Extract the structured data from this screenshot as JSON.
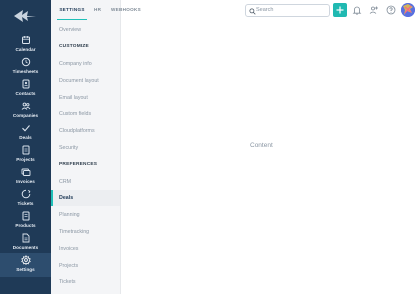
{
  "tabs": [
    {
      "label": "SETTINGS",
      "active": true
    },
    {
      "label": "HR",
      "active": false
    },
    {
      "label": "WEBHOOKS",
      "active": false
    }
  ],
  "nav": [
    {
      "label": "Calendar",
      "icon": "calendar-icon"
    },
    {
      "label": "Timesheets",
      "icon": "timesheets-icon"
    },
    {
      "label": "Contacts",
      "icon": "contacts-icon"
    },
    {
      "label": "Companies",
      "icon": "companies-icon"
    },
    {
      "label": "Deals",
      "icon": "deals-icon"
    },
    {
      "label": "Projects",
      "icon": "projects-icon"
    },
    {
      "label": "Invoices",
      "icon": "invoices-icon"
    },
    {
      "label": "Tickets",
      "icon": "tickets-icon"
    },
    {
      "label": "Products",
      "icon": "products-icon"
    },
    {
      "label": "Documents",
      "icon": "documents-icon"
    },
    {
      "label": "Settings",
      "icon": "settings-icon",
      "active": true
    }
  ],
  "submenu": {
    "overview": "Overview",
    "customize_header": "CUSTOMIZE",
    "customize": [
      "Company info",
      "Document layout",
      "Email layout",
      "Custom fields",
      "Cloudplatforms",
      "Security"
    ],
    "preferences_header": "PREFERENCES",
    "preferences": [
      "CRM",
      "Deals",
      "Planning",
      "Timetracking",
      "Invoices",
      "Projects",
      "Tickets"
    ],
    "active_item": "Deals"
  },
  "header": {
    "search_placeholder": "Search",
    "add_icon": "plus-icon",
    "notification_icon": "bell-icon",
    "user_icon": "user-add-icon",
    "help_icon": "help-icon"
  },
  "content": {
    "label": "Content"
  },
  "colors": {
    "nav_bg": "#1f3a57",
    "accent": "#20c0b8",
    "submenu_bg": "#f4f5f7"
  }
}
